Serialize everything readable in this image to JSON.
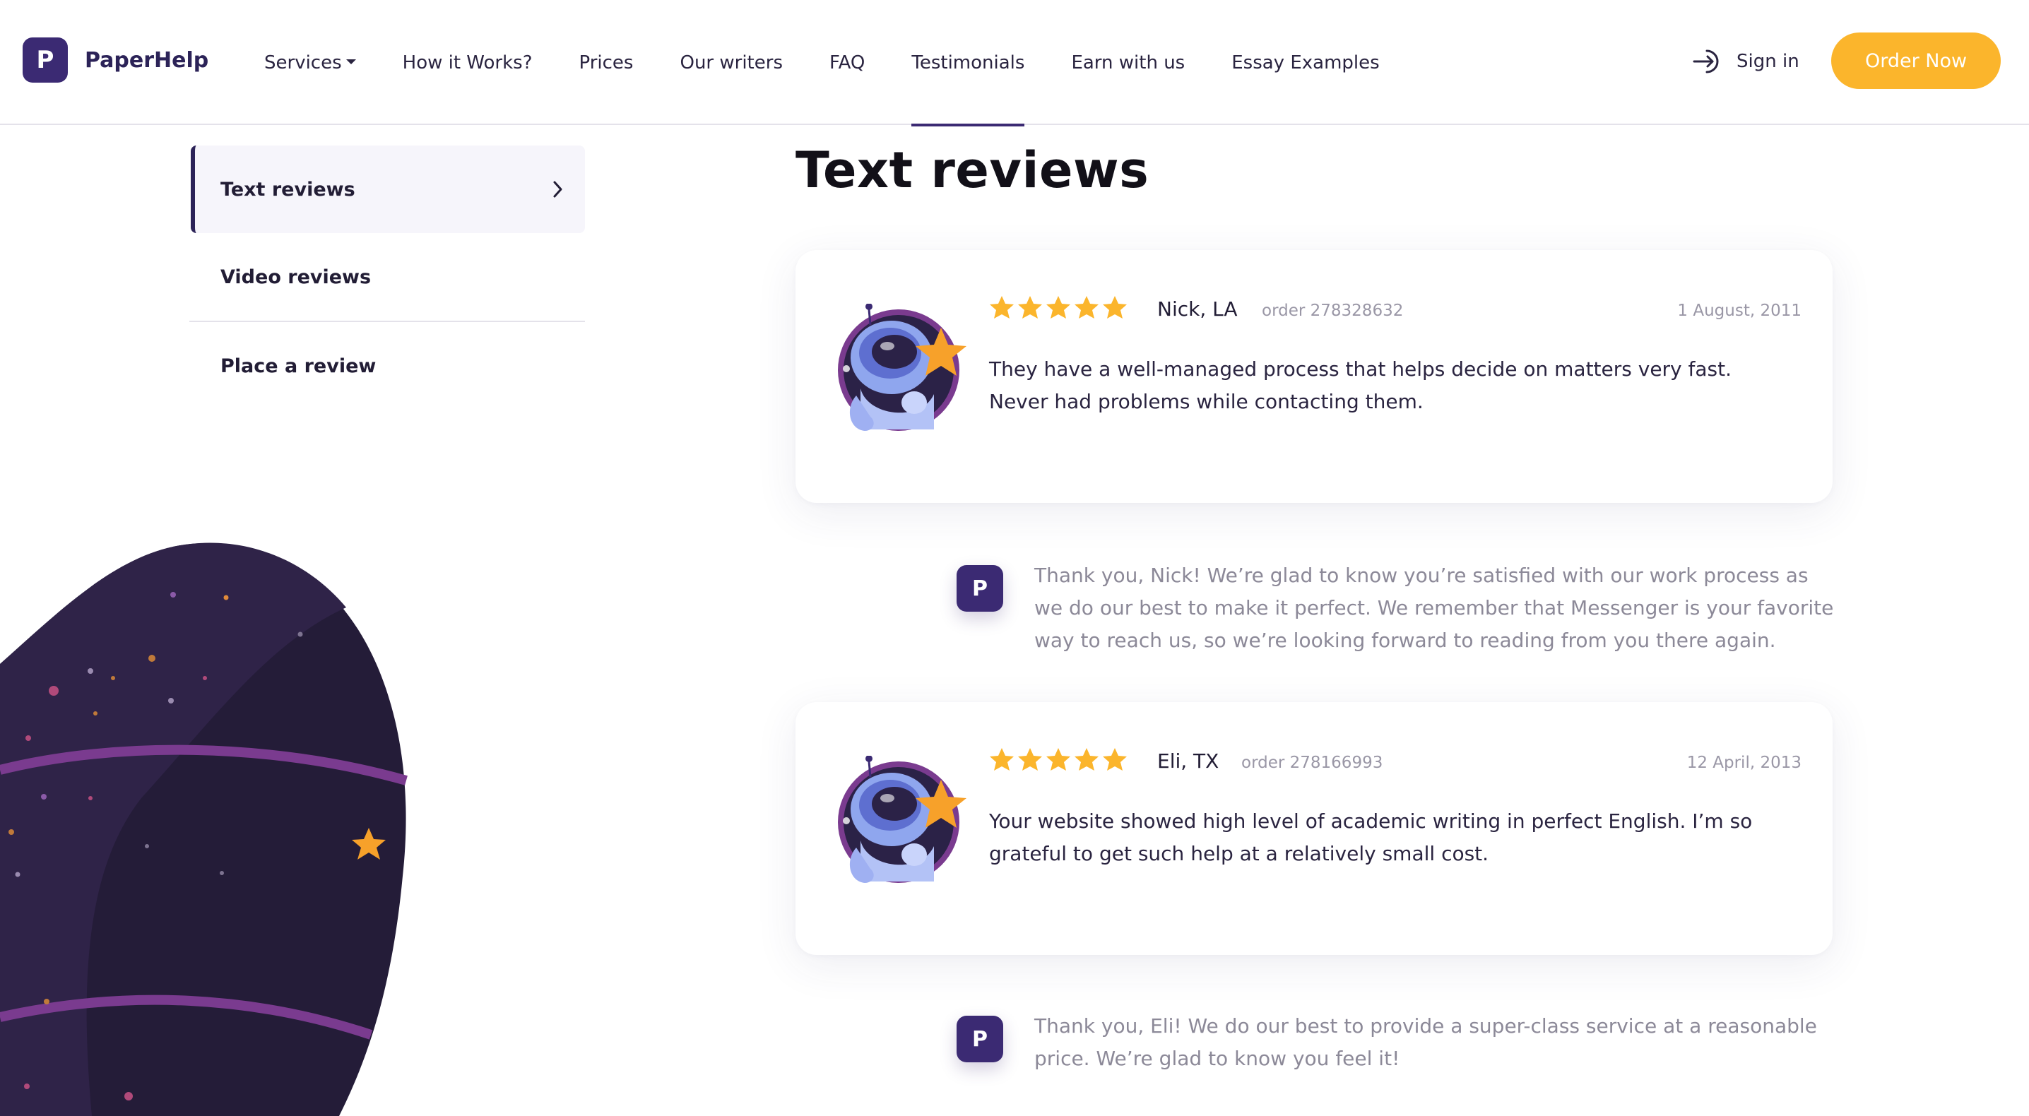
{
  "brand": {
    "logo_letter": "P",
    "name": "PaperHelp",
    "color": "#3b2a73"
  },
  "nav": {
    "items": [
      {
        "label": "Services"
      },
      {
        "label": "How it Works?"
      },
      {
        "label": "Prices"
      },
      {
        "label": "Our writers"
      },
      {
        "label": "FAQ"
      },
      {
        "label": "Testimonials"
      },
      {
        "label": "Earn with us"
      },
      {
        "label": "Essay Examples"
      }
    ],
    "active": "Testimonials"
  },
  "header": {
    "signin_label": "Sign in",
    "signin_icon": "sign-in-arrow-icon",
    "order_label": "Order Now",
    "order_color": "#fbb52c"
  },
  "sidebar": {
    "items": [
      {
        "label": "Text reviews"
      },
      {
        "label": "Video reviews"
      },
      {
        "label": "Place a review"
      }
    ],
    "active": "Text reviews"
  },
  "main": {
    "title": "Text reviews",
    "reviews": [
      {
        "rating": 5,
        "name": "Nick, LA",
        "order": "order 278328632",
        "date": "1 August, 2011",
        "text": "They have a well-managed process that helps decide on matters very fast. Never had problems while contacting them.",
        "reply_letter": "P",
        "reply": "Thank you, Nick! We’re glad to know you’re satisfied with our work process as we do our best to make it perfect. We remember that Messenger is your favorite way to reach us, so we’re looking forward to reading from you there again."
      },
      {
        "rating": 5,
        "name": "Eli, TX",
        "order": "order 278166993",
        "date": "12 April, 2013",
        "text": "Your website showed high level of academic writing in perfect English. I’m so grateful to get such help at a relatively small cost.",
        "reply_letter": "P",
        "reply": "Thank you, Eli! We do our best to provide a super-class service at a reasonable price. We’re glad to know you feel it!"
      }
    ]
  },
  "colors": {
    "star": "#fbb52c",
    "planet": "#231c36",
    "accent_purple": "#7a3b8f"
  }
}
